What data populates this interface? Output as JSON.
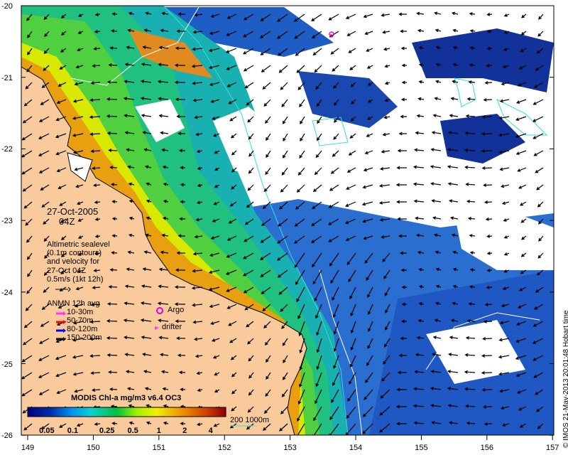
{
  "map": {
    "lon_ticks": [
      "149",
      "150",
      "151",
      "152",
      "153",
      "154",
      "155",
      "156",
      "157"
    ],
    "lat_ticks": [
      "-20",
      "-21",
      "-22",
      "-23",
      "-24",
      "-25",
      "-26"
    ],
    "date": "27-Oct-2005",
    "time": "04Z",
    "land_color": "#F9CA9C"
  },
  "legend": {
    "altimetry_lines": [
      "Altimetric sealevel",
      "(0.1m contours)",
      "and velocity for",
      "27-Oct 04Z",
      "0.5m/s (1kt 12h)"
    ],
    "anmn_title": "ANMN 12h avg",
    "anmn_items": [
      {
        "label": "10-30m",
        "color": "#FF33FF"
      },
      {
        "label": "50-70m",
        "color": "#FF0000"
      },
      {
        "label": "80-120m",
        "color": "#0000FF"
      },
      {
        "label": "150-200m",
        "color": "#000000"
      }
    ],
    "argo_label": "Argo",
    "drifter_label": "drifter",
    "argo_color": "#E000E0"
  },
  "colorbar": {
    "title": "MODIS Chl-a mg/m3 v6.4 OC3",
    "ticks": [
      "0.05",
      "0.1",
      "0.25",
      "0.5",
      "1",
      "2",
      "4"
    ],
    "isobath_label": "200  1000m",
    "isobath_color": "#33DDDD"
  },
  "credit": "© IMOS 21-May-2013 20:01:48 Hobart time"
}
